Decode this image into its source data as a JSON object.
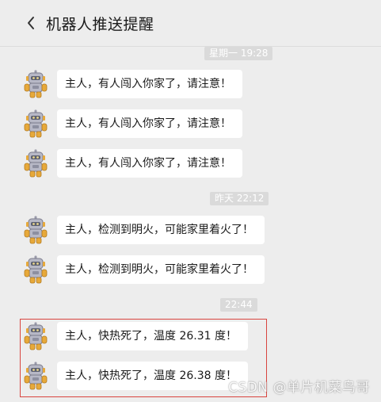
{
  "header": {
    "back_icon": "chevron-left-icon",
    "title": "机器人推送提醒"
  },
  "chat": {
    "time_1": "星期一 19:28",
    "time_2": "昨天 22:12",
    "time_3": "22:44",
    "messages": [
      {
        "text": "主人，有人闯入你家了，请注意！"
      },
      {
        "text": "主人，有人闯入你家了，请注意！"
      },
      {
        "text": "主人，有人闯入你家了，请注意！"
      },
      {
        "text": "主人，检测到明火，可能家里着火了！"
      },
      {
        "text": "主人，检测到明火，可能家里着火了！"
      },
      {
        "text": "主人，快热死了，温度 26.31 度！"
      },
      {
        "text": "主人，快热死了，温度 26.38 度！"
      }
    ],
    "avatar_icon": "robot-icon"
  },
  "watermark": "CSDN @单片机菜鸟哥",
  "colors": {
    "background": "#ededed",
    "bubble": "#ffffff",
    "highlight_border": "#d9453f",
    "time_badge": "#dadada"
  }
}
